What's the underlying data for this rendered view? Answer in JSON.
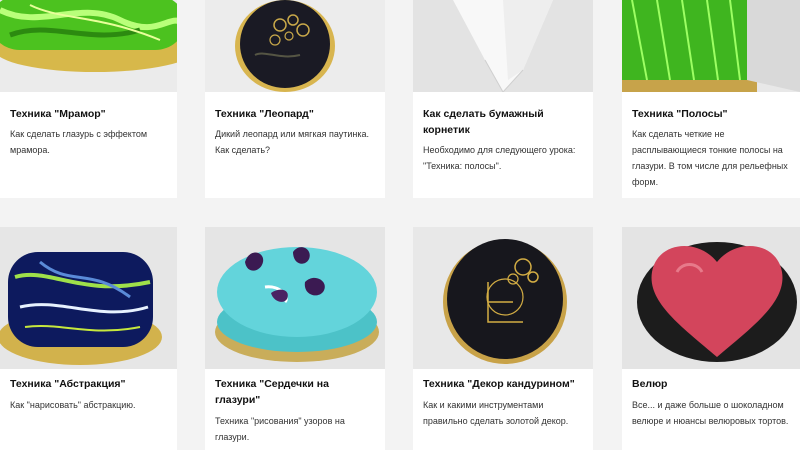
{
  "cards": [
    {
      "title": "Техника \"Мрамор\"",
      "description": "Как сделать глазурь с эффектом мрамора.",
      "image": "green-marble-cake"
    },
    {
      "title": "Техника \"Леопард\"",
      "description": "Дикий леопард или мягкая паутинка. Как сделать?",
      "image": "black-leopard-cake"
    },
    {
      "title": "Как сделать бумажный корнетик",
      "description": "Необходимо для следующего урока: \"Техника: полосы\".",
      "image": "paper-cornet"
    },
    {
      "title": "Техника \"Полосы\"",
      "description": "Как сделать четкие не расплывающиеся тонкие полосы на глазури. В том числе для рельефных форм.",
      "image": "green-stripes-cake"
    },
    {
      "title": "Техника \"Абстракция\"",
      "description": "Как \"нарисовать\" абстракцию.",
      "image": "abstract-navy-cake"
    },
    {
      "title": "Техника \"Сердечки на глазури\"",
      "description": "Техника \"рисования\" узоров на глазури.",
      "image": "turquoise-hearts-cake"
    },
    {
      "title": "Техника \"Декор кандурином\"",
      "description": "Как и какими инструментами правильно сделать золотой декор.",
      "image": "black-gold-decor-cake"
    },
    {
      "title": "Велюр",
      "description": "Все... и даже больше о шоколадном велюре и нюансы велюровых тортов.",
      "image": "velour-heart-cake"
    }
  ]
}
